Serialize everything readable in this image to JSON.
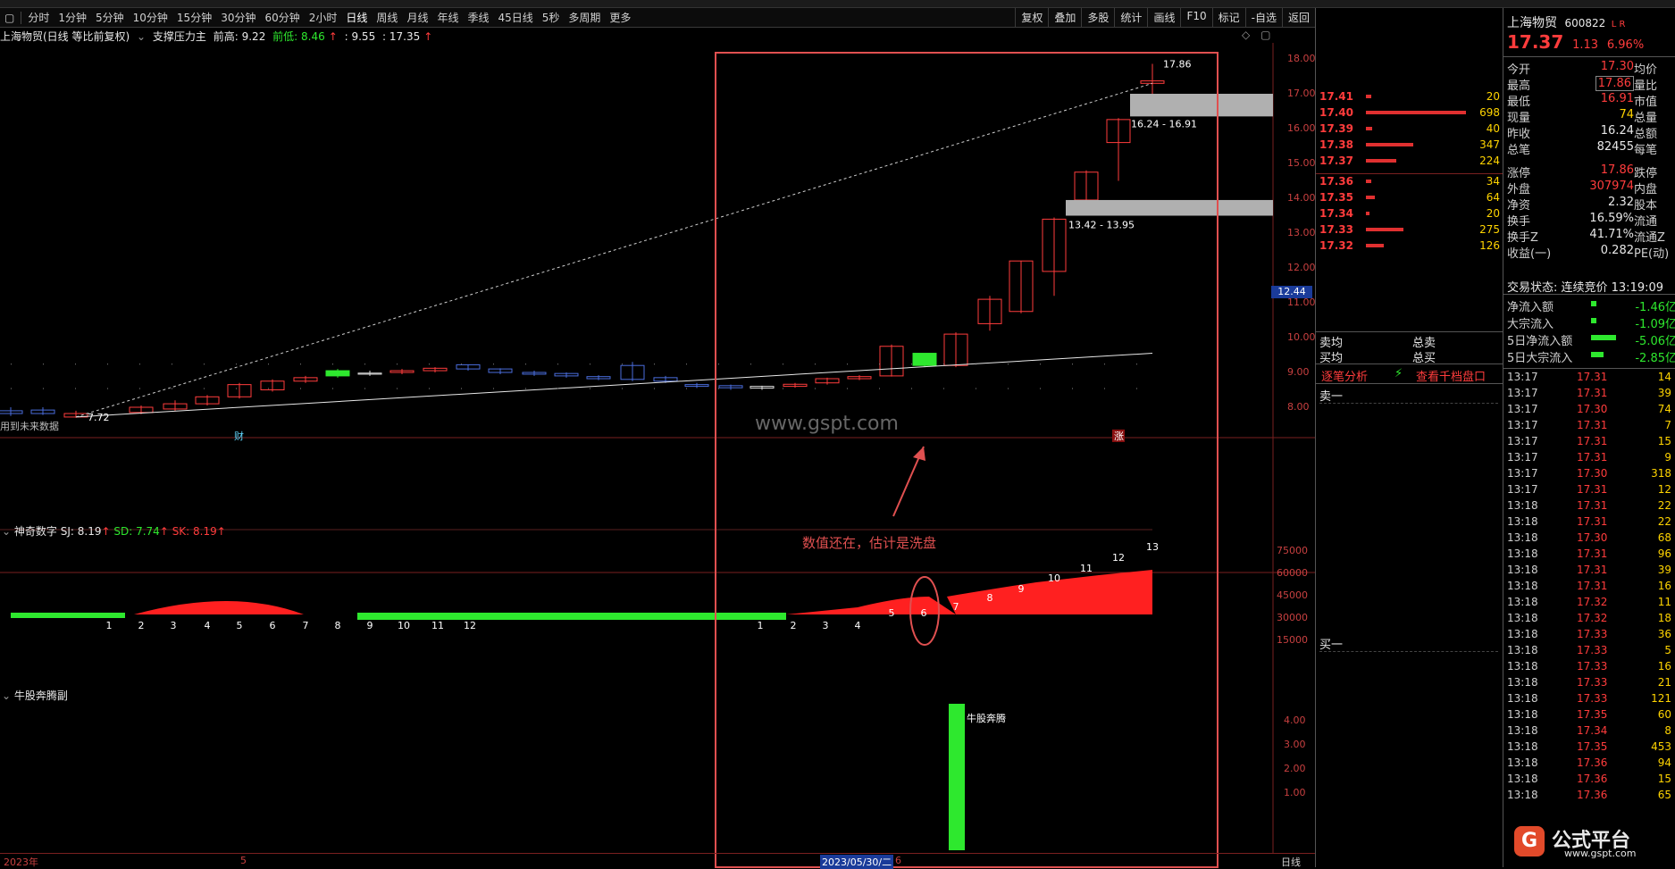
{
  "toolbar": {
    "tabs": [
      "分时",
      "1分钟",
      "5分钟",
      "10分钟",
      "15分钟",
      "30分钟",
      "60分钟",
      "2小时",
      "日线",
      "周线",
      "月线",
      "年线",
      "季线",
      "45日线",
      "5秒",
      "多周期",
      "更多"
    ],
    "right_buttons": [
      "复权",
      "叠加",
      "多股",
      "统计",
      "画线",
      "F10",
      "标记",
      "-自选",
      "返回"
    ]
  },
  "chart_title": {
    "name": "上海物贸(日线 等比前复权)",
    "indicator": "支撑压力主",
    "label_high": "前高: 9.22",
    "label_low": "前低: 8.46",
    "label_mid": ": 9.55",
    "label_last": ": 17.35"
  },
  "main_chart": {
    "price_axis": [
      "18.00",
      "17.00",
      "16.00",
      "15.00",
      "14.00",
      "13.00",
      "12.00",
      "11.00",
      "10.00",
      "9.00",
      "8.00"
    ],
    "current_price_tag": "12.44",
    "high_label": "17.86",
    "low_label": "7.72",
    "zone_upper": "16.24 - 16.91",
    "zone_lower": "13.42 - 13.95",
    "future_label": "用到未来数据",
    "marker_cai": "财",
    "marker_zhang": "涨",
    "annotation": "数值还在，估计是洗盘",
    "watermark": "www.gspt.com"
  },
  "indicator1": {
    "title": "神奇数字",
    "sj": "SJ: 8.19",
    "sd": "SD: 7.74",
    "sk": "SK: 8.19",
    "axis": [
      "75000",
      "60000",
      "45000",
      "30000",
      "15000"
    ],
    "green_counts": [
      "1",
      "2",
      "3",
      "4",
      "5",
      "6",
      "7",
      "8",
      "9",
      "10",
      "11",
      "12"
    ],
    "red_counts": [
      "1",
      "2",
      "3",
      "4",
      "5",
      "6",
      "7",
      "8",
      "9",
      "10",
      "11",
      "12",
      "13"
    ]
  },
  "indicator2": {
    "title": "牛股奔腾副",
    "axis": [
      "4.00",
      "3.00",
      "2.00",
      "1.00"
    ],
    "bar_label": "牛股奔腾"
  },
  "bottom_axis": {
    "year": "2023年",
    "month": "5",
    "cursor_date": "2023/05/30/二",
    "mark_6": "6",
    "period": "日线"
  },
  "orderbook": {
    "asks": [
      {
        "price": "17.41",
        "vol": "20",
        "bar": 4
      },
      {
        "price": "17.40",
        "vol": "698",
        "bar": 80
      },
      {
        "price": "17.39",
        "vol": "40",
        "bar": 5
      },
      {
        "price": "17.38",
        "vol": "347",
        "bar": 38
      },
      {
        "price": "17.37",
        "vol": "224",
        "bar": 24
      }
    ],
    "bids": [
      {
        "price": "17.36",
        "vol": "34",
        "bar": 4
      },
      {
        "price": "17.35",
        "vol": "64",
        "bar": 7
      },
      {
        "price": "17.34",
        "vol": "20",
        "bar": 3
      },
      {
        "price": "17.33",
        "vol": "275",
        "bar": 30
      },
      {
        "price": "17.32",
        "vol": "126",
        "bar": 14
      }
    ],
    "sell_avg": "卖均",
    "total_sell": "总卖",
    "buy_avg": "买均",
    "total_buy": "总买",
    "link_tick": "逐笔分析",
    "link_level": "查看千档盘口",
    "sell_one": "卖一",
    "buy_one": "买一"
  },
  "quote": {
    "name": "上海物贸",
    "code": "600822",
    "tag": "L R",
    "price": "17.37",
    "change": "1.13",
    "pct": "6.96%",
    "rows": [
      {
        "l": "今开",
        "v": "17.30",
        "l2": "均价",
        "c": "red"
      },
      {
        "l": "最高",
        "v": "17.86",
        "l2": "量比",
        "c": "red"
      },
      {
        "l": "最低",
        "v": "16.91",
        "l2": "市值",
        "c": "red"
      },
      {
        "l": "现量",
        "v": "74",
        "l2": "总量",
        "c": "yellow"
      },
      {
        "l": "昨收",
        "v": "16.24",
        "l2": "总额",
        "c": "white"
      },
      {
        "l": "总笔",
        "v": "82455",
        "l2": "每笔",
        "c": "white"
      },
      {
        "l": "涨停",
        "v": "17.86",
        "l2": "跌停",
        "c": "red"
      },
      {
        "l": "外盘",
        "v": "307974",
        "l2": "内盘",
        "c": "red"
      },
      {
        "l": "净资",
        "v": "2.32",
        "l2": "股本",
        "c": "white"
      },
      {
        "l": "换手",
        "v": "16.59%",
        "l2": "流通",
        "c": "white"
      },
      {
        "l": "换手Z",
        "v": "41.71%",
        "l2": "流通Z",
        "c": "white"
      },
      {
        "l": "收益(一)",
        "v": "0.282",
        "l2": "PE(动)",
        "c": "white"
      }
    ],
    "trade_status": "交易状态: 连续竞价 13:19:09",
    "flows": [
      {
        "l": "净流入额",
        "v": "-1.46亿"
      },
      {
        "l": "大宗流入",
        "v": "-1.09亿"
      },
      {
        "l": "5日净流入额",
        "v": "-5.06亿"
      },
      {
        "l": "5日大宗流入",
        "v": "-2.85亿"
      }
    ],
    "ticks": [
      [
        "13:17",
        "17.31",
        "14"
      ],
      [
        "13:17",
        "17.31",
        "39"
      ],
      [
        "13:17",
        "17.30",
        "74"
      ],
      [
        "13:17",
        "17.31",
        "7"
      ],
      [
        "13:17",
        "17.31",
        "15"
      ],
      [
        "13:17",
        "17.31",
        "9"
      ],
      [
        "13:17",
        "17.30",
        "318"
      ],
      [
        "13:17",
        "17.31",
        "12"
      ],
      [
        "13:18",
        "17.31",
        "22"
      ],
      [
        "13:18",
        "17.31",
        "22"
      ],
      [
        "13:18",
        "17.30",
        "68"
      ],
      [
        "13:18",
        "17.31",
        "96"
      ],
      [
        "13:18",
        "17.31",
        "39"
      ],
      [
        "13:18",
        "17.31",
        "16"
      ],
      [
        "13:18",
        "17.32",
        "11"
      ],
      [
        "13:18",
        "17.32",
        "18"
      ],
      [
        "13:18",
        "17.33",
        "36"
      ],
      [
        "13:18",
        "17.33",
        "5"
      ],
      [
        "13:18",
        "17.33",
        "16"
      ],
      [
        "13:18",
        "17.33",
        "21"
      ],
      [
        "13:18",
        "17.33",
        "121"
      ],
      [
        "13:18",
        "17.35",
        "60"
      ],
      [
        "13:18",
        "17.34",
        "8"
      ],
      [
        "13:18",
        "17.35",
        "453"
      ],
      [
        "13:18",
        "17.36",
        "94"
      ],
      [
        "13:18",
        "17.36",
        "15"
      ],
      [
        "13:18",
        "17.36",
        "65"
      ]
    ]
  },
  "logo": {
    "text": "公式平台",
    "url": "www.gspt.com",
    "letter": "G"
  },
  "colors": {
    "up": "#ff3c3c",
    "down": "#2ee82e",
    "accent": "#ffd400",
    "panel_line": "#7a2020",
    "box": "#e05050"
  }
}
